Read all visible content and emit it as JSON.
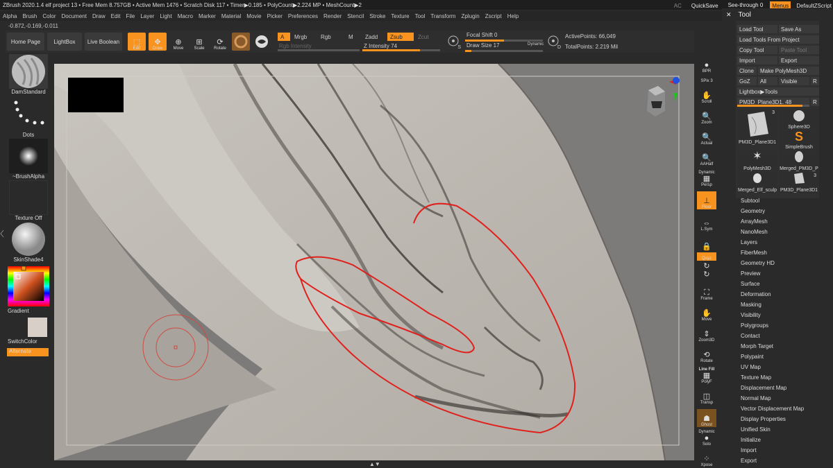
{
  "title_bar": {
    "text": "ZBrush 2020.1.4   elf project 13    • Free Mem 8.757GB • Active Mem 1476 • Scratch Disk 117  • Timer▶0.185 • PolyCount▶2.224 MP  • MeshCount▶2",
    "ac": "AC",
    "quicksave": "QuickSave",
    "see_through": "See-through  0",
    "menus": "Menus",
    "default_zscript": "DefaultZScript"
  },
  "menu": [
    "Alpha",
    "Brush",
    "Color",
    "Document",
    "Draw",
    "Edit",
    "File",
    "Layer",
    "Light",
    "Macro",
    "Marker",
    "Material",
    "Movie",
    "Picker",
    "Preferences",
    "Render",
    "Stencil",
    "Stroke",
    "Texture",
    "Tool",
    "Transform",
    "Zplugin",
    "Zscript",
    "Help"
  ],
  "coords": "-0.872,-0.169,-0.011",
  "shelf": {
    "home_page": "Home Page",
    "lightbox": "LightBox",
    "live_boolean": "Live Boolean",
    "edit": "Edit",
    "draw": "Draw",
    "move": "Move",
    "scale": "Scale",
    "rotate": "Rotate",
    "a_label": "A",
    "mrgb": "Mrgb",
    "rgb": "Rgb",
    "m": "M",
    "zadd": "Zadd",
    "zsub": "Zsub",
    "zcut": "Zcut",
    "rgb_intensity": "Rgb Intensity",
    "z_intensity": "Z Intensity 74",
    "z_intensity_value": 0.74,
    "focal_shift": "Focal Shift 0",
    "focal_shift_value": 0.5,
    "draw_size": "Draw Size 17",
    "draw_size_value": 0.08,
    "dynamic": "Dynamic",
    "s_badge": "S",
    "d_badge": "D",
    "active_points": "ActivePoints: 66,049",
    "total_points": "TotalPoints: 2.219 Mil"
  },
  "left_panel": {
    "brush": "DamStandard",
    "stroke": "Dots",
    "alpha": "~BrushAlpha",
    "texture": "Texture Off",
    "material": "SkinShade4",
    "gradient": "Gradient",
    "switch_color": "SwitchColor",
    "alternate": "Alternate"
  },
  "right_bar": {
    "bpr": "BPR",
    "spix": "SPix 3",
    "scroll": "Scroll",
    "zoom": "Zoom",
    "actual": "Actual",
    "aahalf": "AAHalf",
    "dynamic": "Dynamic",
    "persp": "Persp",
    "floor": "Floor",
    "lsym": "L.Sym",
    "xyz": "Qxyz",
    "frame": "Frame",
    "move": "Move",
    "zoom3d": "Zoom3D",
    "rotate": "Rotate",
    "line_fill": "Line Fill",
    "polyf": "PolyF",
    "transp": "Transp",
    "ghost": "Ghost",
    "dynamic2": "Dynamic",
    "solo": "Solo",
    "xpose": "Xpose"
  },
  "tool_panel": {
    "title": "Tool",
    "load_tool": "Load Tool",
    "save_as": "Save As",
    "load_from_project": "Load Tools From Project",
    "copy_tool": "Copy Tool",
    "paste_tool": "Paste Tool",
    "import": "Import",
    "export": "Export",
    "clone": "Clone",
    "make_polymesh": "Make PolyMesh3D",
    "goz": "GoZ",
    "all": "All",
    "visible": "Visible",
    "r": "R",
    "lightbox_tools": "Lightbox▶Tools",
    "current_tool": "PM3D_Plane3D1. 48",
    "tools": [
      {
        "label": "PM3D_Plane3D1",
        "count": "3"
      },
      {
        "label": "Sphere3D",
        "count": ""
      },
      {
        "label": "SimpleBrush",
        "count": ""
      },
      {
        "label": "PolyMesh3D",
        "count": ""
      },
      {
        "label": "Merged_PM3D_P",
        "count": ""
      },
      {
        "label": "Merged_Elf_sculp",
        "count": ""
      },
      {
        "label": "PM3D_Plane3D1",
        "count": "3"
      }
    ],
    "sections": [
      "Subtool",
      "Geometry",
      "ArrayMesh",
      "NanoMesh",
      "Layers",
      "FiberMesh",
      "Geometry HD",
      "Preview",
      "Surface",
      "Deformation",
      "Masking",
      "Visibility",
      "Polygroups",
      "Contact",
      "Morph Target",
      "Polypaint",
      "UV Map",
      "Texture Map",
      "Displacement Map",
      "Normal Map",
      "Vector Displacement Map",
      "Display Properties",
      "Unified Skin",
      "Initialize",
      "Import",
      "Export"
    ]
  },
  "colors": {
    "accent": "#f7931e",
    "annotation": "#e0201c",
    "background": "#2a2a2a",
    "viewport": "#807f7c"
  }
}
